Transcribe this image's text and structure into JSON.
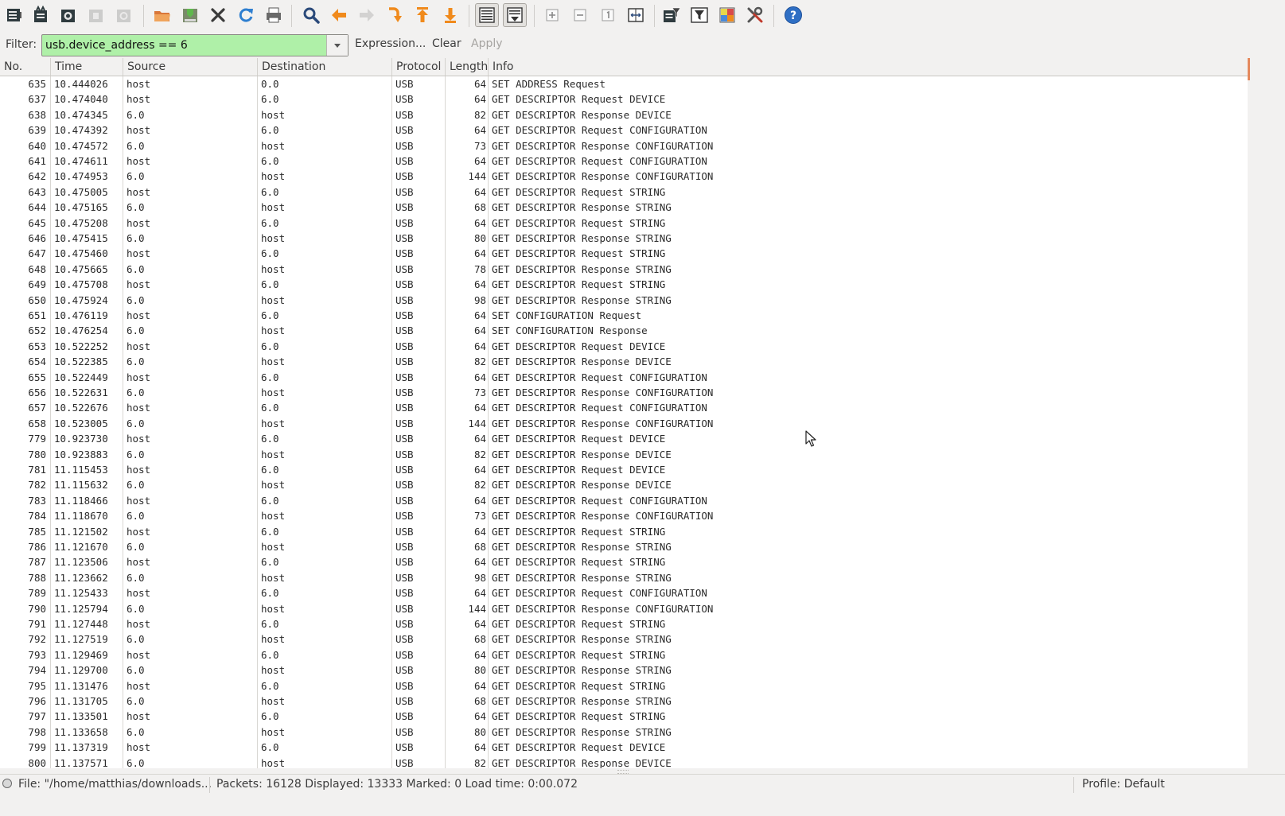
{
  "toolbar": {
    "buttons": [
      {
        "name": "interfaces-icon",
        "enabled": true
      },
      {
        "name": "capture-options-icon",
        "enabled": true
      },
      {
        "name": "start-capture-icon",
        "enabled": true
      },
      {
        "name": "stop-capture-icon",
        "enabled": false
      },
      {
        "name": "restart-capture-icon",
        "enabled": false
      },
      {
        "name": "open-file-icon",
        "enabled": true
      },
      {
        "name": "save-file-icon",
        "enabled": true
      },
      {
        "name": "close-file-icon",
        "enabled": true
      },
      {
        "name": "reload-icon",
        "enabled": true
      },
      {
        "name": "print-icon",
        "enabled": true
      },
      {
        "name": "find-packet-icon",
        "enabled": true
      },
      {
        "name": "go-back-icon",
        "enabled": true
      },
      {
        "name": "go-forward-icon",
        "enabled": false
      },
      {
        "name": "go-to-packet-icon",
        "enabled": true
      },
      {
        "name": "go-first-packet-icon",
        "enabled": true
      },
      {
        "name": "go-last-packet-icon",
        "enabled": true
      },
      {
        "name": "colorize-icon",
        "enabled": true,
        "pressed": true
      },
      {
        "name": "auto-scroll-icon",
        "enabled": true,
        "pressed": true
      },
      {
        "name": "zoom-in-icon",
        "enabled": true
      },
      {
        "name": "zoom-out-icon",
        "enabled": true
      },
      {
        "name": "normal-size-icon",
        "enabled": true
      },
      {
        "name": "resize-columns-icon",
        "enabled": true
      },
      {
        "name": "capture-filters-icon",
        "enabled": true
      },
      {
        "name": "display-filters-icon",
        "enabled": true
      },
      {
        "name": "coloring-rules-icon",
        "enabled": true
      },
      {
        "name": "preferences-icon",
        "enabled": true
      },
      {
        "name": "help-icon",
        "enabled": true
      }
    ]
  },
  "filter": {
    "label": "Filter:",
    "value": "usb.device_address == 6",
    "expression_label": "Expression...",
    "clear_label": "Clear",
    "apply_label": "Apply",
    "valid_color": "#aff0a8"
  },
  "columns": [
    "No.",
    "Time",
    "Source",
    "Destination",
    "Protocol",
    "Length",
    "Info"
  ],
  "packets": [
    [
      "635",
      "10.444026",
      "host",
      "0.0",
      "USB",
      "64",
      "SET ADDRESS Request"
    ],
    [
      "637",
      "10.474040",
      "host",
      "6.0",
      "USB",
      "64",
      "GET DESCRIPTOR Request DEVICE"
    ],
    [
      "638",
      "10.474345",
      "6.0",
      "host",
      "USB",
      "82",
      "GET DESCRIPTOR Response DEVICE"
    ],
    [
      "639",
      "10.474392",
      "host",
      "6.0",
      "USB",
      "64",
      "GET DESCRIPTOR Request CONFIGURATION"
    ],
    [
      "640",
      "10.474572",
      "6.0",
      "host",
      "USB",
      "73",
      "GET DESCRIPTOR Response CONFIGURATION"
    ],
    [
      "641",
      "10.474611",
      "host",
      "6.0",
      "USB",
      "64",
      "GET DESCRIPTOR Request CONFIGURATION"
    ],
    [
      "642",
      "10.474953",
      "6.0",
      "host",
      "USB",
      "144",
      "GET DESCRIPTOR Response CONFIGURATION"
    ],
    [
      "643",
      "10.475005",
      "host",
      "6.0",
      "USB",
      "64",
      "GET DESCRIPTOR Request STRING"
    ],
    [
      "644",
      "10.475165",
      "6.0",
      "host",
      "USB",
      "68",
      "GET DESCRIPTOR Response STRING"
    ],
    [
      "645",
      "10.475208",
      "host",
      "6.0",
      "USB",
      "64",
      "GET DESCRIPTOR Request STRING"
    ],
    [
      "646",
      "10.475415",
      "6.0",
      "host",
      "USB",
      "80",
      "GET DESCRIPTOR Response STRING"
    ],
    [
      "647",
      "10.475460",
      "host",
      "6.0",
      "USB",
      "64",
      "GET DESCRIPTOR Request STRING"
    ],
    [
      "648",
      "10.475665",
      "6.0",
      "host",
      "USB",
      "78",
      "GET DESCRIPTOR Response STRING"
    ],
    [
      "649",
      "10.475708",
      "host",
      "6.0",
      "USB",
      "64",
      "GET DESCRIPTOR Request STRING"
    ],
    [
      "650",
      "10.475924",
      "6.0",
      "host",
      "USB",
      "98",
      "GET DESCRIPTOR Response STRING"
    ],
    [
      "651",
      "10.476119",
      "host",
      "6.0",
      "USB",
      "64",
      "SET CONFIGURATION Request"
    ],
    [
      "652",
      "10.476254",
      "6.0",
      "host",
      "USB",
      "64",
      "SET CONFIGURATION Response"
    ],
    [
      "653",
      "10.522252",
      "host",
      "6.0",
      "USB",
      "64",
      "GET DESCRIPTOR Request DEVICE"
    ],
    [
      "654",
      "10.522385",
      "6.0",
      "host",
      "USB",
      "82",
      "GET DESCRIPTOR Response DEVICE"
    ],
    [
      "655",
      "10.522449",
      "host",
      "6.0",
      "USB",
      "64",
      "GET DESCRIPTOR Request CONFIGURATION"
    ],
    [
      "656",
      "10.522631",
      "6.0",
      "host",
      "USB",
      "73",
      "GET DESCRIPTOR Response CONFIGURATION"
    ],
    [
      "657",
      "10.522676",
      "host",
      "6.0",
      "USB",
      "64",
      "GET DESCRIPTOR Request CONFIGURATION"
    ],
    [
      "658",
      "10.523005",
      "6.0",
      "host",
      "USB",
      "144",
      "GET DESCRIPTOR Response CONFIGURATION"
    ],
    [
      "779",
      "10.923730",
      "host",
      "6.0",
      "USB",
      "64",
      "GET DESCRIPTOR Request DEVICE"
    ],
    [
      "780",
      "10.923883",
      "6.0",
      "host",
      "USB",
      "82",
      "GET DESCRIPTOR Response DEVICE"
    ],
    [
      "781",
      "11.115453",
      "host",
      "6.0",
      "USB",
      "64",
      "GET DESCRIPTOR Request DEVICE"
    ],
    [
      "782",
      "11.115632",
      "6.0",
      "host",
      "USB",
      "82",
      "GET DESCRIPTOR Response DEVICE"
    ],
    [
      "783",
      "11.118466",
      "host",
      "6.0",
      "USB",
      "64",
      "GET DESCRIPTOR Request CONFIGURATION"
    ],
    [
      "784",
      "11.118670",
      "6.0",
      "host",
      "USB",
      "73",
      "GET DESCRIPTOR Response CONFIGURATION"
    ],
    [
      "785",
      "11.121502",
      "host",
      "6.0",
      "USB",
      "64",
      "GET DESCRIPTOR Request STRING"
    ],
    [
      "786",
      "11.121670",
      "6.0",
      "host",
      "USB",
      "68",
      "GET DESCRIPTOR Response STRING"
    ],
    [
      "787",
      "11.123506",
      "host",
      "6.0",
      "USB",
      "64",
      "GET DESCRIPTOR Request STRING"
    ],
    [
      "788",
      "11.123662",
      "6.0",
      "host",
      "USB",
      "98",
      "GET DESCRIPTOR Response STRING"
    ],
    [
      "789",
      "11.125433",
      "host",
      "6.0",
      "USB",
      "64",
      "GET DESCRIPTOR Request CONFIGURATION"
    ],
    [
      "790",
      "11.125794",
      "6.0",
      "host",
      "USB",
      "144",
      "GET DESCRIPTOR Response CONFIGURATION"
    ],
    [
      "791",
      "11.127448",
      "host",
      "6.0",
      "USB",
      "64",
      "GET DESCRIPTOR Request STRING"
    ],
    [
      "792",
      "11.127519",
      "6.0",
      "host",
      "USB",
      "68",
      "GET DESCRIPTOR Response STRING"
    ],
    [
      "793",
      "11.129469",
      "host",
      "6.0",
      "USB",
      "64",
      "GET DESCRIPTOR Request STRING"
    ],
    [
      "794",
      "11.129700",
      "6.0",
      "host",
      "USB",
      "80",
      "GET DESCRIPTOR Response STRING"
    ],
    [
      "795",
      "11.131476",
      "host",
      "6.0",
      "USB",
      "64",
      "GET DESCRIPTOR Request STRING"
    ],
    [
      "796",
      "11.131705",
      "6.0",
      "host",
      "USB",
      "68",
      "GET DESCRIPTOR Response STRING"
    ],
    [
      "797",
      "11.133501",
      "host",
      "6.0",
      "USB",
      "64",
      "GET DESCRIPTOR Request STRING"
    ],
    [
      "798",
      "11.133658",
      "6.0",
      "host",
      "USB",
      "80",
      "GET DESCRIPTOR Response STRING"
    ],
    [
      "799",
      "11.137319",
      "host",
      "6.0",
      "USB",
      "64",
      "GET DESCRIPTOR Request DEVICE"
    ],
    [
      "800",
      "11.137571",
      "6.0",
      "host",
      "USB",
      "82",
      "GET DESCRIPTOR Response DEVICE"
    ]
  ],
  "status": {
    "file": "File: \"/home/matthias/downloads...",
    "packets": "Packets: 16128 Displayed: 13333 Marked: 0 Load time: 0:00.072",
    "profile": "Profile: Default"
  },
  "colors": {
    "scroll_indicator": "#e58a5e"
  }
}
